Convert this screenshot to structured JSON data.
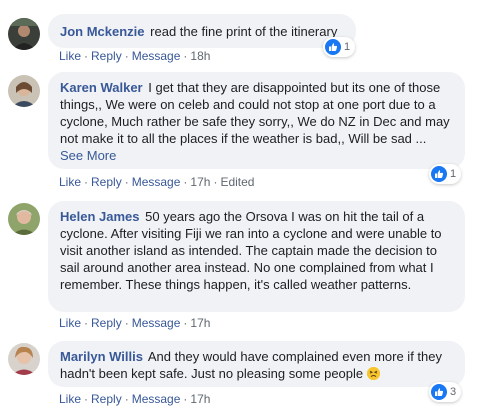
{
  "comments": [
    {
      "author": "Jon Mckenzie",
      "text": "read the fine print of the itinerary",
      "actions": {
        "like": "Like",
        "reply": "Reply",
        "message": "Message",
        "time": "18h",
        "edited": ""
      },
      "reactions": "1"
    },
    {
      "author": "Karen Walker",
      "text": "I get that they are disappointed but its one of those things,, We were on celeb and could not stop at one port due to a cyclone, Much rather be safe they sorry,, We do NZ in Dec and may not make it to all the places if the weather is bad,, Will be sad ...",
      "see_more": "See More",
      "actions": {
        "like": "Like",
        "reply": "Reply",
        "message": "Message",
        "time": "17h",
        "edited": "Edited"
      },
      "reactions": "1"
    },
    {
      "author": "Helen James",
      "text": "50 years ago the Orsova I was on hit the tail of a cyclone. After visiting Fiji we ran into a cyclone and were unable to visit another island as intended. The captain made the decision to sail around another area instead. No one complained from what I remember. These things happen, it's called weather patterns.",
      "actions": {
        "like": "Like",
        "reply": "Reply",
        "message": "Message",
        "time": "17h",
        "edited": ""
      },
      "reactions": ""
    },
    {
      "author": "Marilyn Willis",
      "text": "And they would have complained even more if they hadn't been kept safe. Just no pleasing some people",
      "emoji": "persevering-face-emoji",
      "actions": {
        "like": "Like",
        "reply": "Reply",
        "message": "Message",
        "time": "17h",
        "edited": ""
      },
      "reactions": "3"
    }
  ],
  "colors": {
    "link": "#385898",
    "bubble": "#f0f2f5",
    "like_blue": "#1877f2",
    "muted": "#606770"
  }
}
